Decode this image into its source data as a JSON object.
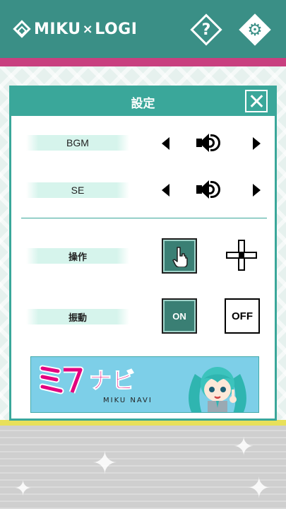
{
  "header": {
    "app_title_left": "MIKU",
    "app_title_times": "×",
    "app_title_right": "LOGI",
    "help_glyph": "?",
    "help_icon": "question-mark-icon",
    "settings_icon": "gear-icon"
  },
  "dialog": {
    "title": "設定",
    "close_icon": "close-icon",
    "rows": {
      "bgm": {
        "label": "BGM"
      },
      "se": {
        "label": "SE"
      },
      "control": {
        "label": "操作"
      },
      "vibration": {
        "label": "振動",
        "on": "ON",
        "off": "OFF",
        "selected": "ON"
      }
    },
    "banner": {
      "logo_text": "ナビ",
      "subtitle": "MIKU NAVI"
    }
  },
  "colors": {
    "header": "#3a8f86",
    "accent_stripe": "#c83f7f",
    "dialog_teal": "#3aa79a",
    "selected_option": "#3a7f74",
    "banner_pink": "#e3007f"
  }
}
